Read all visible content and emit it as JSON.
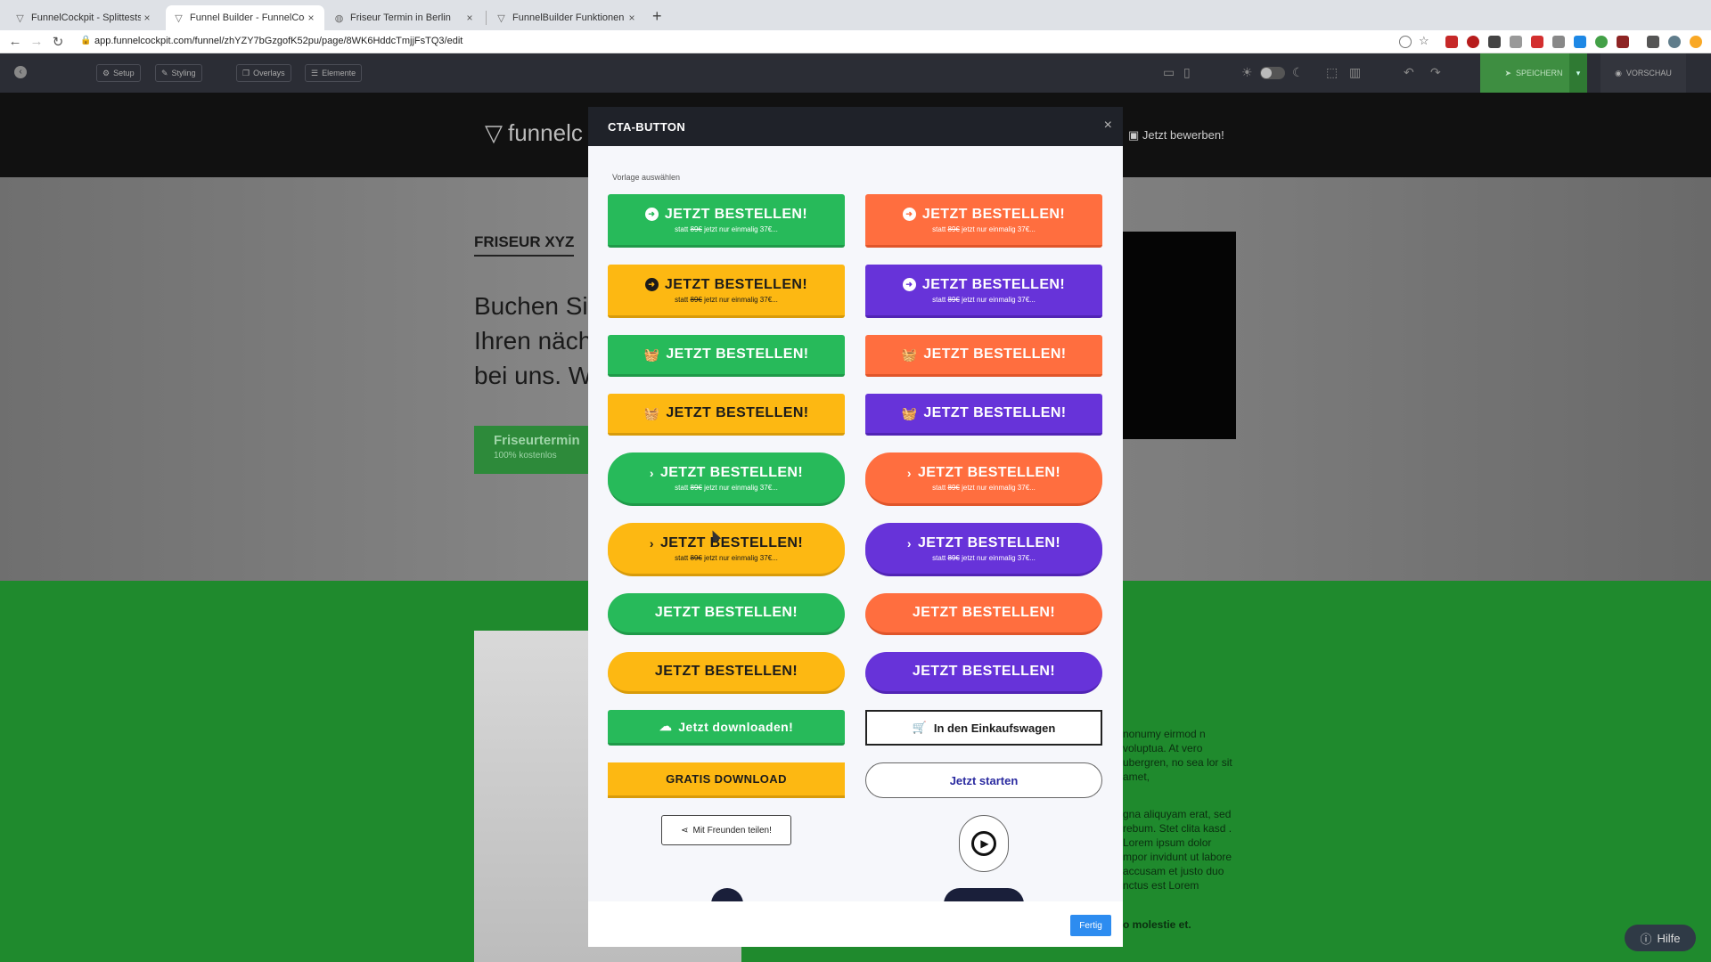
{
  "browser": {
    "tabs": [
      {
        "title": "FunnelCockpit - Splittests, Ma",
        "icon": "funnel-icon",
        "active": false
      },
      {
        "title": "Funnel Builder - FunnelCockpit",
        "icon": "funnel-icon",
        "active": true
      },
      {
        "title": "Friseur Termin in Berlin",
        "icon": "globe-icon",
        "active": false
      },
      {
        "title": "FunnelBuilder Funktionen & Ele",
        "icon": "funnel-icon",
        "active": false
      }
    ],
    "url": "app.funnelcockpit.com/funnel/zhYZY7bGzgofK52pu/page/8WK6HddcTmjjFsTQ3/edit"
  },
  "editor": {
    "buttons": [
      "Setup",
      "Styling",
      "Overlays",
      "Elemente"
    ],
    "save_label": "SPEICHERN",
    "preview_label": "VORSCHAU"
  },
  "page": {
    "logo_text": "funnelc",
    "apply_label": "Jetzt bewerben!",
    "section_label": "FRISEUR XYZ",
    "headline_lines": [
      "Buchen Si",
      "Ihren näch",
      "bei uns. W"
    ],
    "hero_button": {
      "label": "Friseurtermin",
      "sub": "100% kostenlos"
    },
    "body_text_1": "nonumy eirmod n voluptua. At vero ubergren, no sea lor sit amet,",
    "body_text_2": "gna aliquyam erat, sed rebum. Stet clita kasd . Lorem ipsum dolor mpor invidunt ut labore accusam et justo duo nctus est Lorem",
    "body_text_3": "o molestie et.",
    "help_label": "Hilfe"
  },
  "modal": {
    "title": "CTA-BUTTON",
    "select_label": "Vorlage auswählen",
    "cta_text": "JETZT BESTELLEN!",
    "sub_old_price": "89€",
    "sub_prefix": "statt",
    "sub_suffix": "jetzt nur einmalig 37€...",
    "download_label": "Jetzt downloaden!",
    "cart_label": "In den Einkaufswagen",
    "gratis_label": "GRATIS DOWNLOAD",
    "start_label": "Jetzt starten",
    "share_label": "Mit Freunden teilen!",
    "done_label": "Fertig"
  },
  "colors": {
    "green": "#27ba5a",
    "orange": "#ff6e3f",
    "yellow": "#fdb812",
    "purple": "#6733d9",
    "done_blue": "#2d8cf0"
  }
}
